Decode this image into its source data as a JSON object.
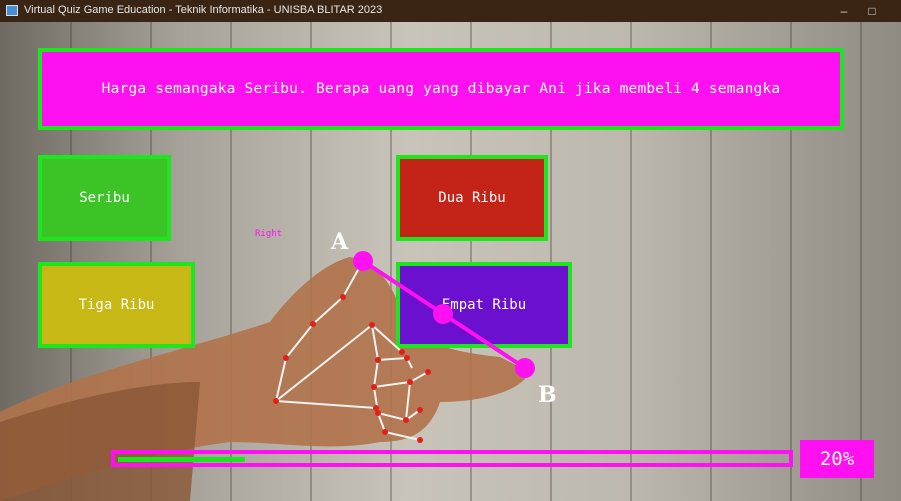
{
  "window": {
    "title": "Virtual Quiz Game Education - Teknik Informatika - UNISBA BLITAR 2023",
    "minimize_icon": "minimize-icon",
    "maximize_icon": "maximize-icon"
  },
  "quiz": {
    "question": "Harga semangaka Seribu. Berapa uang yang dibayar Ani jika membeli 4 semangka",
    "options": [
      "Seribu",
      "Dua Ribu",
      "Tiga Ribu",
      "Empat Ribu"
    ],
    "hand_label": "Right",
    "point_a": "A",
    "point_b": "B"
  },
  "progress": {
    "value": 0.2,
    "label": "20%"
  },
  "colors": {
    "accent": "#ff10f0",
    "border": "#1ee61e",
    "option_a": "#3cc426",
    "option_b": "#c42418",
    "option_c": "#c8b816",
    "option_d": "#6c10d0"
  }
}
